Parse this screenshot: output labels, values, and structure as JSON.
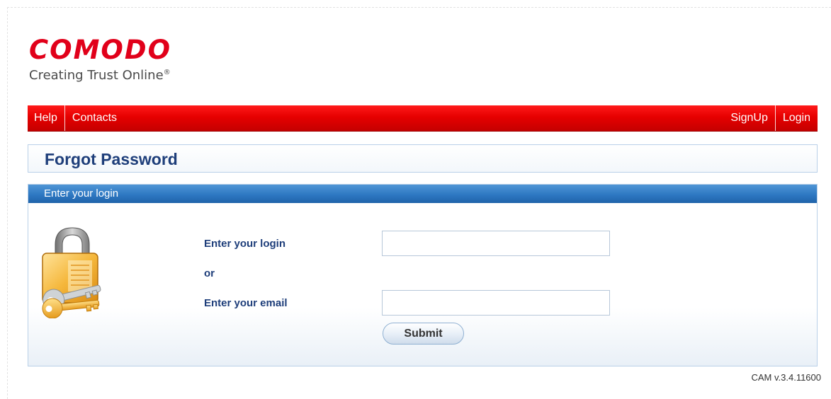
{
  "brand": {
    "logo_text": "COMODO",
    "tagline": "Creating Trust Online",
    "tagline_mark": "®",
    "color": "#e1001a"
  },
  "nav": {
    "left_items": [
      {
        "label": "Help"
      },
      {
        "label": "Contacts"
      }
    ],
    "right_items": [
      {
        "label": "SignUp"
      },
      {
        "label": "Login"
      }
    ],
    "color": "#e60000"
  },
  "page": {
    "title": "Forgot Password"
  },
  "panel": {
    "header": "Enter your login",
    "icon": "padlock-with-key-icon",
    "form": {
      "login_label": "Enter your login",
      "login_value": "",
      "or_label": "or",
      "email_label": "Enter your email",
      "email_value": "",
      "submit_label": "Submit"
    }
  },
  "footer": {
    "version": "CAM v.3.4.11600"
  }
}
